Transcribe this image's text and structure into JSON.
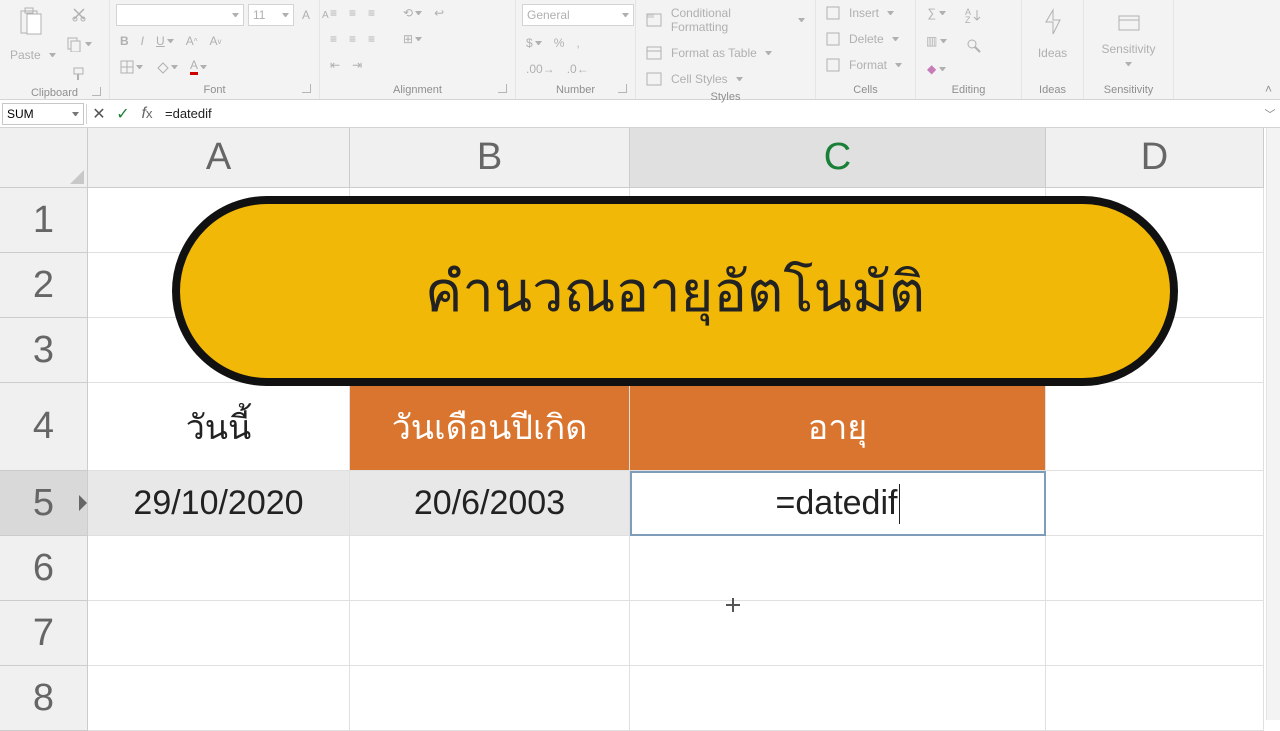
{
  "ribbon": {
    "groups": {
      "clipboard": "Clipboard",
      "font": "Font",
      "alignment": "Alignment",
      "number": "Number",
      "styles": "Styles",
      "cells": "Cells",
      "editing": "Editing",
      "ideas": "Ideas",
      "sensitivity": "Sensitivity"
    },
    "paste": "Paste",
    "font_name": "",
    "font_size": "11",
    "number_format": "General",
    "cond_fmt": "Conditional Formatting",
    "fmt_table": "Format as Table",
    "cell_styles": "Cell Styles",
    "insert": "Insert",
    "delete": "Delete",
    "format": "Format",
    "ideas_btn": "Ideas",
    "sensitivity_btn": "Sensitivity"
  },
  "formula_bar": {
    "name_box": "SUM",
    "formula": "=datedif"
  },
  "columns": {
    "A": "A",
    "B": "B",
    "C": "C",
    "D": "D"
  },
  "rows": {
    "1": "1",
    "2": "2",
    "3": "3",
    "4": "4",
    "5": "5",
    "6": "6",
    "7": "7",
    "8": "8"
  },
  "cells": {
    "A4": "วันนี้",
    "B4": "วันเดือนปีเกิด",
    "C4": "อายุ",
    "A5": "29/10/2020",
    "B5": "20/6/2003",
    "C5": "=datedif"
  },
  "banner": "คำนวณอายุอัตโนมัติ"
}
